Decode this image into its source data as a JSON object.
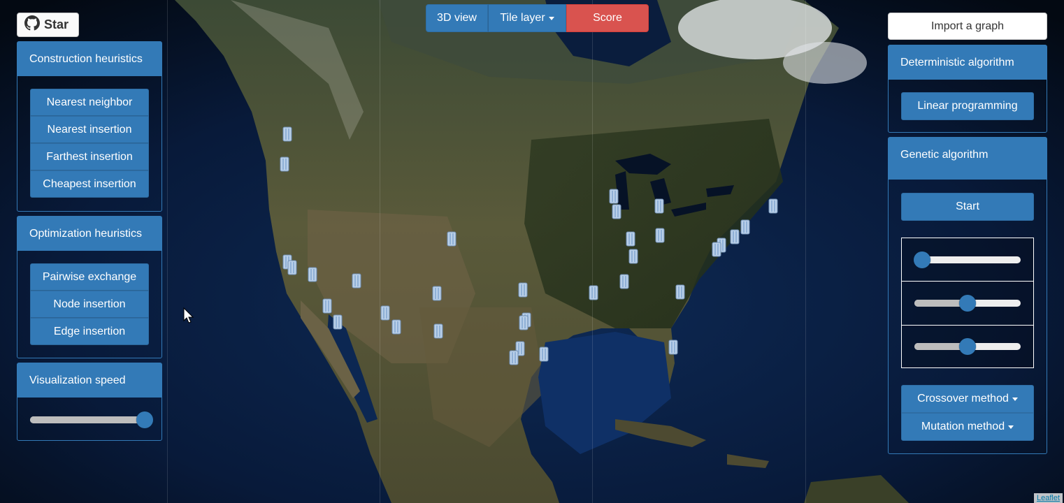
{
  "github": {
    "label": "Star",
    "icon": "github-icon"
  },
  "toolbar": {
    "view_3d": "3D view",
    "tile_layer": "Tile layer",
    "score": "Score"
  },
  "left": {
    "construction": {
      "title": "Construction heuristics",
      "items": [
        "Nearest neighbor",
        "Nearest insertion",
        "Farthest insertion",
        "Cheapest insertion"
      ]
    },
    "optimization": {
      "title": "Optimization heuristics",
      "items": [
        "Pairwise exchange",
        "Node insertion",
        "Edge insertion"
      ]
    },
    "speed": {
      "title": "Visualization speed",
      "value": 1.0
    }
  },
  "right": {
    "import_label": "Import a graph",
    "deterministic": {
      "title": "Deterministic algorithm",
      "button": "Linear programming"
    },
    "genetic": {
      "title": "Genetic algorithm",
      "start": "Start",
      "sliders": [
        0.07,
        0.5,
        0.5
      ],
      "crossover": "Crossover method",
      "mutation": "Mutation method"
    }
  },
  "map": {
    "attribution": "Leaflet",
    "marker_icon": "city-building-icon"
  },
  "colors": {
    "primary": "#337ab7",
    "danger": "#d9534f"
  }
}
